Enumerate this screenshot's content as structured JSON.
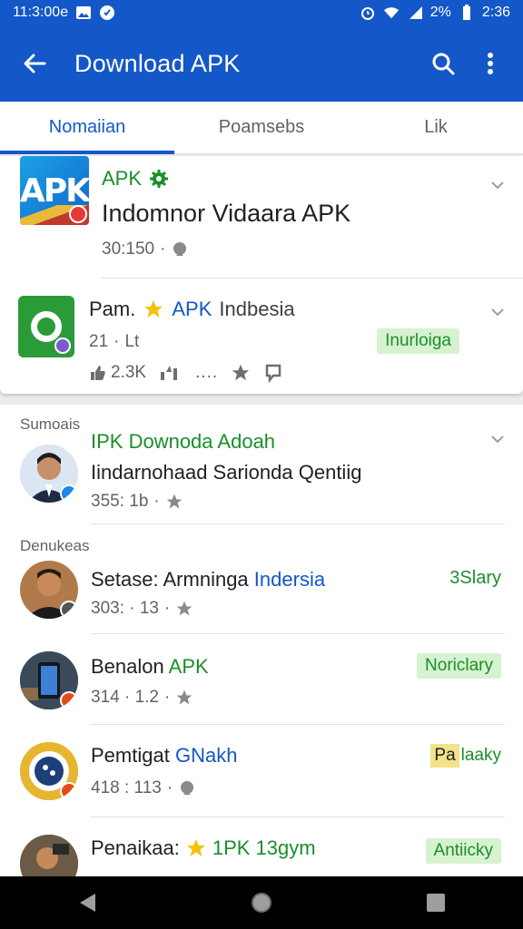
{
  "status_bar": {
    "time_left": "11:3:00e",
    "battery": "2%",
    "time_right": "2:36"
  },
  "app_bar": {
    "title": "Download APK"
  },
  "tabs": [
    {
      "label": "Nomaiian",
      "active": true
    },
    {
      "label": "Poamsebs",
      "active": false
    },
    {
      "label": "Lik",
      "active": false
    }
  ],
  "card": {
    "item1": {
      "tag": "APK",
      "title": "Indomnor Vidaara APK",
      "meta": "30:150",
      "logo_text": "APK"
    },
    "item2": {
      "title_a": "Pam.",
      "title_b": "APK",
      "title_c": "Indbesia",
      "meta": "21",
      "meta_b": "Lt",
      "pill": "Inurloiga",
      "likes": "2.3K",
      "dots": "...."
    }
  },
  "list": {
    "section1": "Sumoais",
    "section2": "Denukeas",
    "items": [
      {
        "title": "IPK Downoda Adoah",
        "sub": "Iindarnohaad Sarionda Qentiig",
        "meta": "355: 1b",
        "badge": "",
        "badge_type": ""
      },
      {
        "title": "Setase: Armninga",
        "title_b": "Indersia",
        "meta": "303: · 13",
        "badge": "3Slary",
        "badge_type": "text"
      },
      {
        "title": "Benalon",
        "title_b": "APK",
        "meta": "314 · 1.2",
        "badge": "Noriclary",
        "badge_type": "pill"
      },
      {
        "title": "Pemtigat",
        "title_b": "GNakh",
        "meta": "418 : 113",
        "badge_a": "Pa",
        "badge": "laaky",
        "badge_type": "yellow"
      },
      {
        "title": "Penaikaa:",
        "title_b": "1PK 13gym",
        "meta": "",
        "badge": "Antiicky",
        "badge_type": "pill"
      }
    ]
  },
  "colors": {
    "primary": "#1457c8",
    "green": "#1a8f2a",
    "pill_bg": "#d6f2d0"
  }
}
